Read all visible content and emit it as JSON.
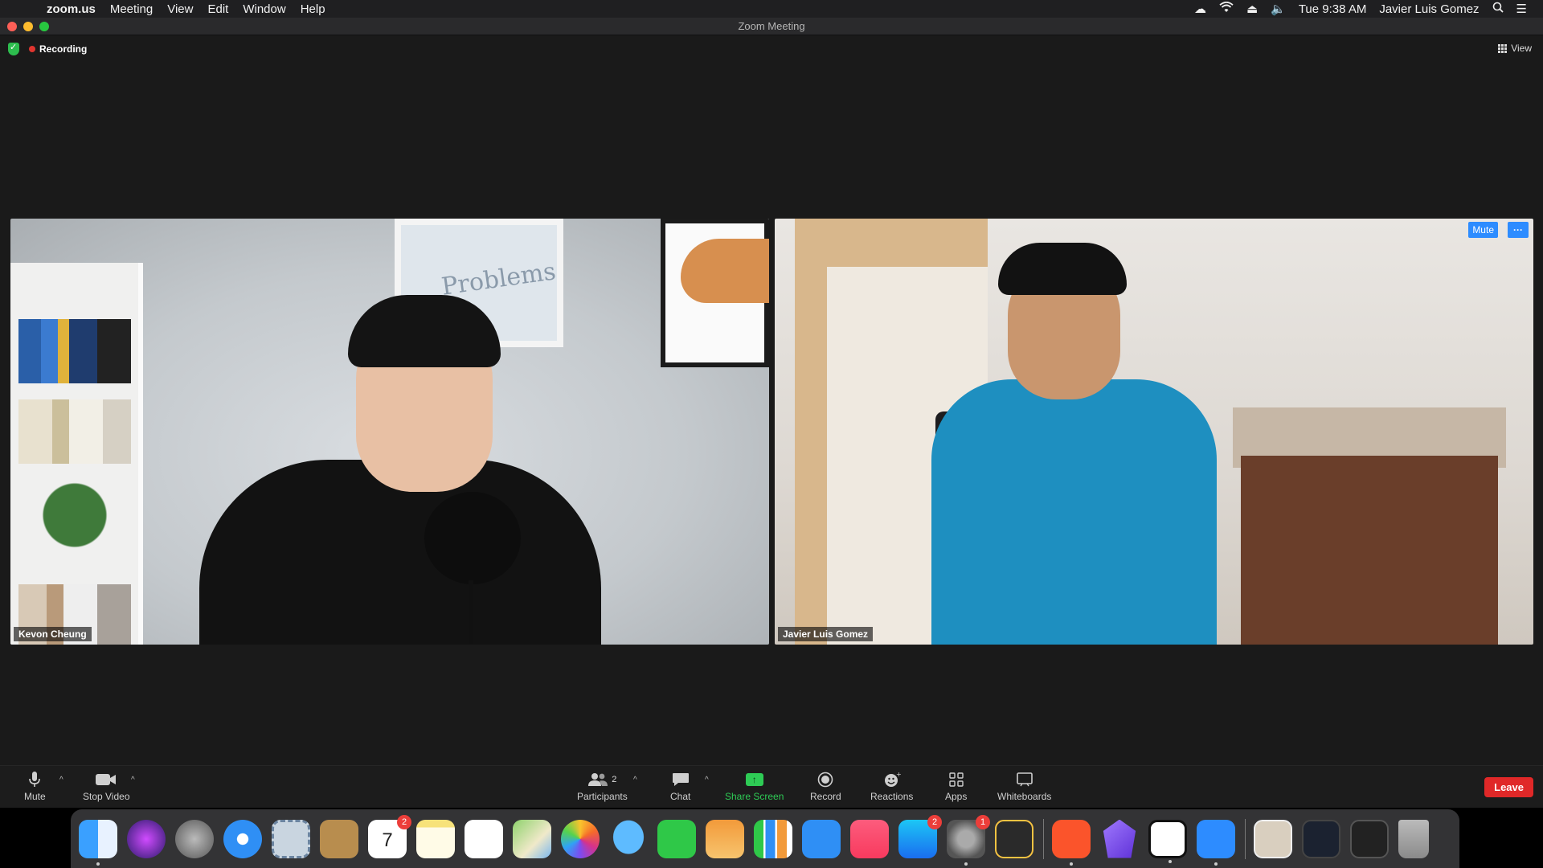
{
  "menubar": {
    "app_name": "zoom.us",
    "menus": [
      "Meeting",
      "View",
      "Edit",
      "Window",
      "Help"
    ],
    "clock": "Tue 9:38 AM",
    "user": "Javier Luis Gomez"
  },
  "window": {
    "title": "Zoom Meeting"
  },
  "status": {
    "recording_label": "Recording",
    "view_label": "View"
  },
  "participants": [
    {
      "name": "Kevon Cheung"
    },
    {
      "name": "Javier Luis Gomez"
    }
  ],
  "tile_overlay": {
    "mute_label": "Mute",
    "more_label": "···"
  },
  "poster_text": "Problems",
  "toolbar": {
    "mute": "Mute",
    "stop_video": "Stop Video",
    "participants": "Participants",
    "participants_count": "2",
    "chat": "Chat",
    "share_screen": "Share Screen",
    "record": "Record",
    "reactions": "Reactions",
    "apps": "Apps",
    "whiteboards": "Whiteboards",
    "leave": "Leave"
  },
  "dock": {
    "calendar_badge": "2",
    "calendar_day": "7",
    "appstore_badge": "2",
    "prefs_badge": "1"
  },
  "colors": {
    "accent_blue": "#2d8cff",
    "share_green": "#2ecb55",
    "leave_red": "#e02828",
    "recording_red": "#e0352f"
  }
}
